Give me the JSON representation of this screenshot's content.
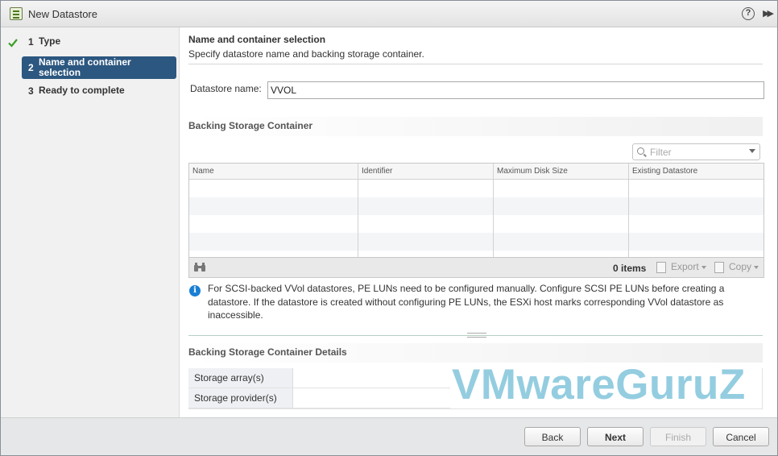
{
  "window": {
    "title": "New Datastore",
    "help_glyph": "?",
    "expand_glyph": "▶▶"
  },
  "wizard": {
    "steps": [
      {
        "number": "1",
        "label": "Type",
        "state": "completed"
      },
      {
        "number": "2",
        "label": "Name and container selection",
        "state": "active"
      },
      {
        "number": "3",
        "label": "Ready to complete",
        "state": "pending"
      }
    ]
  },
  "page": {
    "title": "Name and container selection",
    "subtitle": "Specify datastore name and backing storage container."
  },
  "datastore_name": {
    "label": "Datastore name:",
    "value": "VVOL"
  },
  "backing": {
    "section_title": "Backing Storage Container",
    "filter_placeholder": "Filter",
    "columns": [
      "Name",
      "Identifier",
      "Maximum Disk Size",
      "Existing Datastore"
    ],
    "rows": [],
    "item_count": "0 items",
    "export_label": "Export",
    "copy_label": "Copy"
  },
  "info": {
    "text": "For SCSI-backed VVol datastores, PE LUNs need to be configured manually. Configure SCSI PE LUNs before creating a datastore. If the datastore is created without configuring PE LUNs, the ESXi host marks corresponding VVol datastore as inaccessible."
  },
  "details": {
    "section_title": "Backing Storage Container Details",
    "fields": [
      {
        "label": "Storage array(s)",
        "value": ""
      },
      {
        "label": "Storage provider(s)",
        "value": ""
      }
    ]
  },
  "watermark": "VMwareGuruZ",
  "buttons": {
    "back": "Back",
    "next": "Next",
    "finish": "Finish",
    "cancel": "Cancel"
  },
  "colors": {
    "active_step": "#2c5780",
    "checkmark": "#3aa028",
    "info": "#1a7fd4",
    "watermark": "#8fcbdf"
  }
}
